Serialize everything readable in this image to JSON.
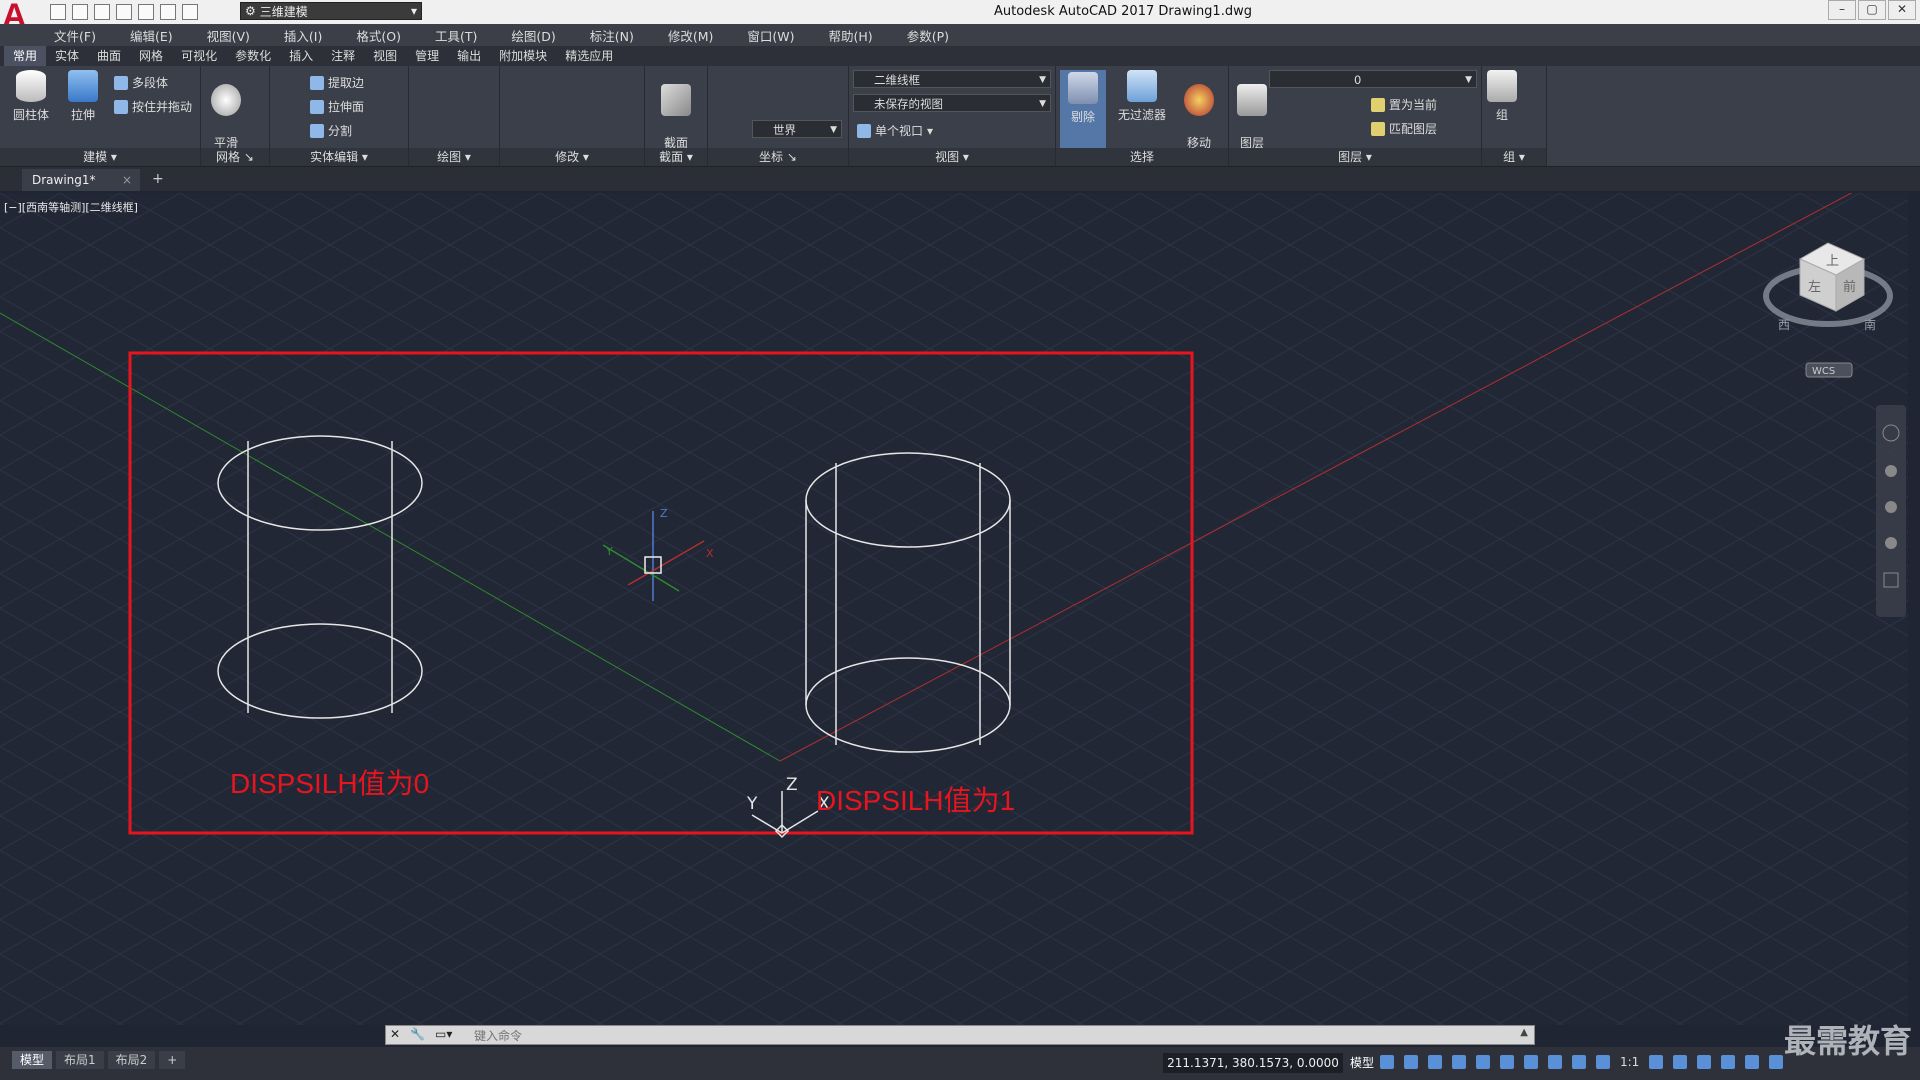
{
  "app": {
    "logo": "A",
    "title": "Autodesk AutoCAD 2017    Drawing1.dwg",
    "workspace": "三维建模",
    "window_controls": [
      "–",
      "▢",
      "✕"
    ]
  },
  "menubar": {
    "items": [
      "文件(F)",
      "编辑(E)",
      "视图(V)",
      "插入(I)",
      "格式(O)",
      "工具(T)",
      "绘图(D)",
      "标注(N)",
      "修改(M)",
      "窗口(W)",
      "帮助(H)",
      "参数(P)"
    ]
  },
  "ribbon_tabs": [
    "常用",
    "实体",
    "曲面",
    "网格",
    "可视化",
    "参数化",
    "插入",
    "注释",
    "视图",
    "管理",
    "输出",
    "附加模块",
    "精选应用"
  ],
  "ribbon": {
    "modeling": {
      "title": "建模",
      "cylinder": "圆柱体",
      "extrude": "拉伸",
      "polysolid": "多段体",
      "presspull": "按住并拖动"
    },
    "mesh": {
      "title": "网格",
      "smooth": "平滑\n对象"
    },
    "solid_edit": {
      "title": "实体编辑",
      "extract": "提取边",
      "extrude_face": "拉伸面",
      "separate": "分割"
    },
    "draw": {
      "title": "绘图"
    },
    "modify": {
      "title": "修改"
    },
    "section": {
      "title": "截面",
      "plane": "截面\n平面"
    },
    "coordinates": {
      "title": "坐标",
      "ucs": "世界"
    },
    "view": {
      "title": "视图",
      "visual_style": "二维线框",
      "named_view": "未保存的视图",
      "viewport": "单个视口"
    },
    "selection": {
      "title": "选择",
      "cull": "剔除",
      "no_filter": "无过滤器",
      "gizmo": "移动\n小控件"
    },
    "layers": {
      "title": "图层",
      "layer_props": "图层\n特性",
      "current_layer": "0",
      "set_current": "置为当前",
      "match_layer": "匹配图层"
    },
    "groups": {
      "title": "组",
      "group": "组"
    }
  },
  "doc_tab": {
    "name": "Drawing1*",
    "close": "×",
    "new": "+"
  },
  "viewport": {
    "label": "[−][西南等轴测][二维线框]",
    "annotation_left": "DISPSILH值为0",
    "annotation_right": "DISPSILH值为1",
    "ucs_labels": {
      "x": "X",
      "y": "Y",
      "z": "Z"
    },
    "viewcube": {
      "top": "上",
      "front": "前",
      "left": "左",
      "west": "西",
      "south": "南",
      "wcs": "WCS"
    },
    "colors": {
      "highlight_box": "#e8141e",
      "background": "#212735",
      "x_axis": "#b03030",
      "y_axis": "#2e8a2e"
    }
  },
  "command_line": {
    "placeholder": "键入命令"
  },
  "status": {
    "layouts": [
      "模型",
      "布局1",
      "布局2"
    ],
    "coords": "211.1371, 380.1573, 0.0000",
    "mode": "模型",
    "scale": "1:1"
  },
  "watermark": "最需教育"
}
